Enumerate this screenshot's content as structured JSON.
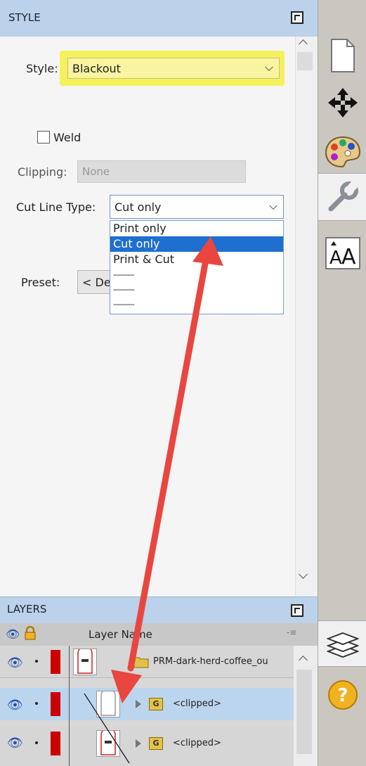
{
  "style_panel": {
    "title": "STYLE",
    "style_label": "Style:",
    "style_value": "Blackout",
    "weld_label": "Weld",
    "weld_checked": false,
    "clipping_label": "Clipping:",
    "clipping_value": "None",
    "cut_line_label": "Cut Line Type:",
    "cut_line_value": "Cut only",
    "cut_line_options": [
      "Print only",
      "Cut only",
      "Print & Cut",
      "----------",
      "----------",
      "----------"
    ],
    "cut_line_selected": "Cut only",
    "preset_label": "Preset:",
    "preset_value": "< De"
  },
  "layers_panel": {
    "title": "LAYERS",
    "column_header": "Layer Name",
    "rows": [
      {
        "name": "PRM-dark-herd-coffee_ou"
      },
      {
        "name": "<clipped>",
        "badge": "G"
      },
      {
        "name": "<clipped>",
        "badge": "G"
      }
    ]
  },
  "colors": {
    "accent_highlight": "#f5f15c",
    "selection": "#1e6fd0",
    "arrow": "#e8463f",
    "panel_header": "#bcd1ea"
  },
  "icons": [
    "page-icon",
    "move-icon",
    "palette-icon",
    "wrench-icon",
    "text-size-icon",
    "layers-icon",
    "help-icon"
  ]
}
